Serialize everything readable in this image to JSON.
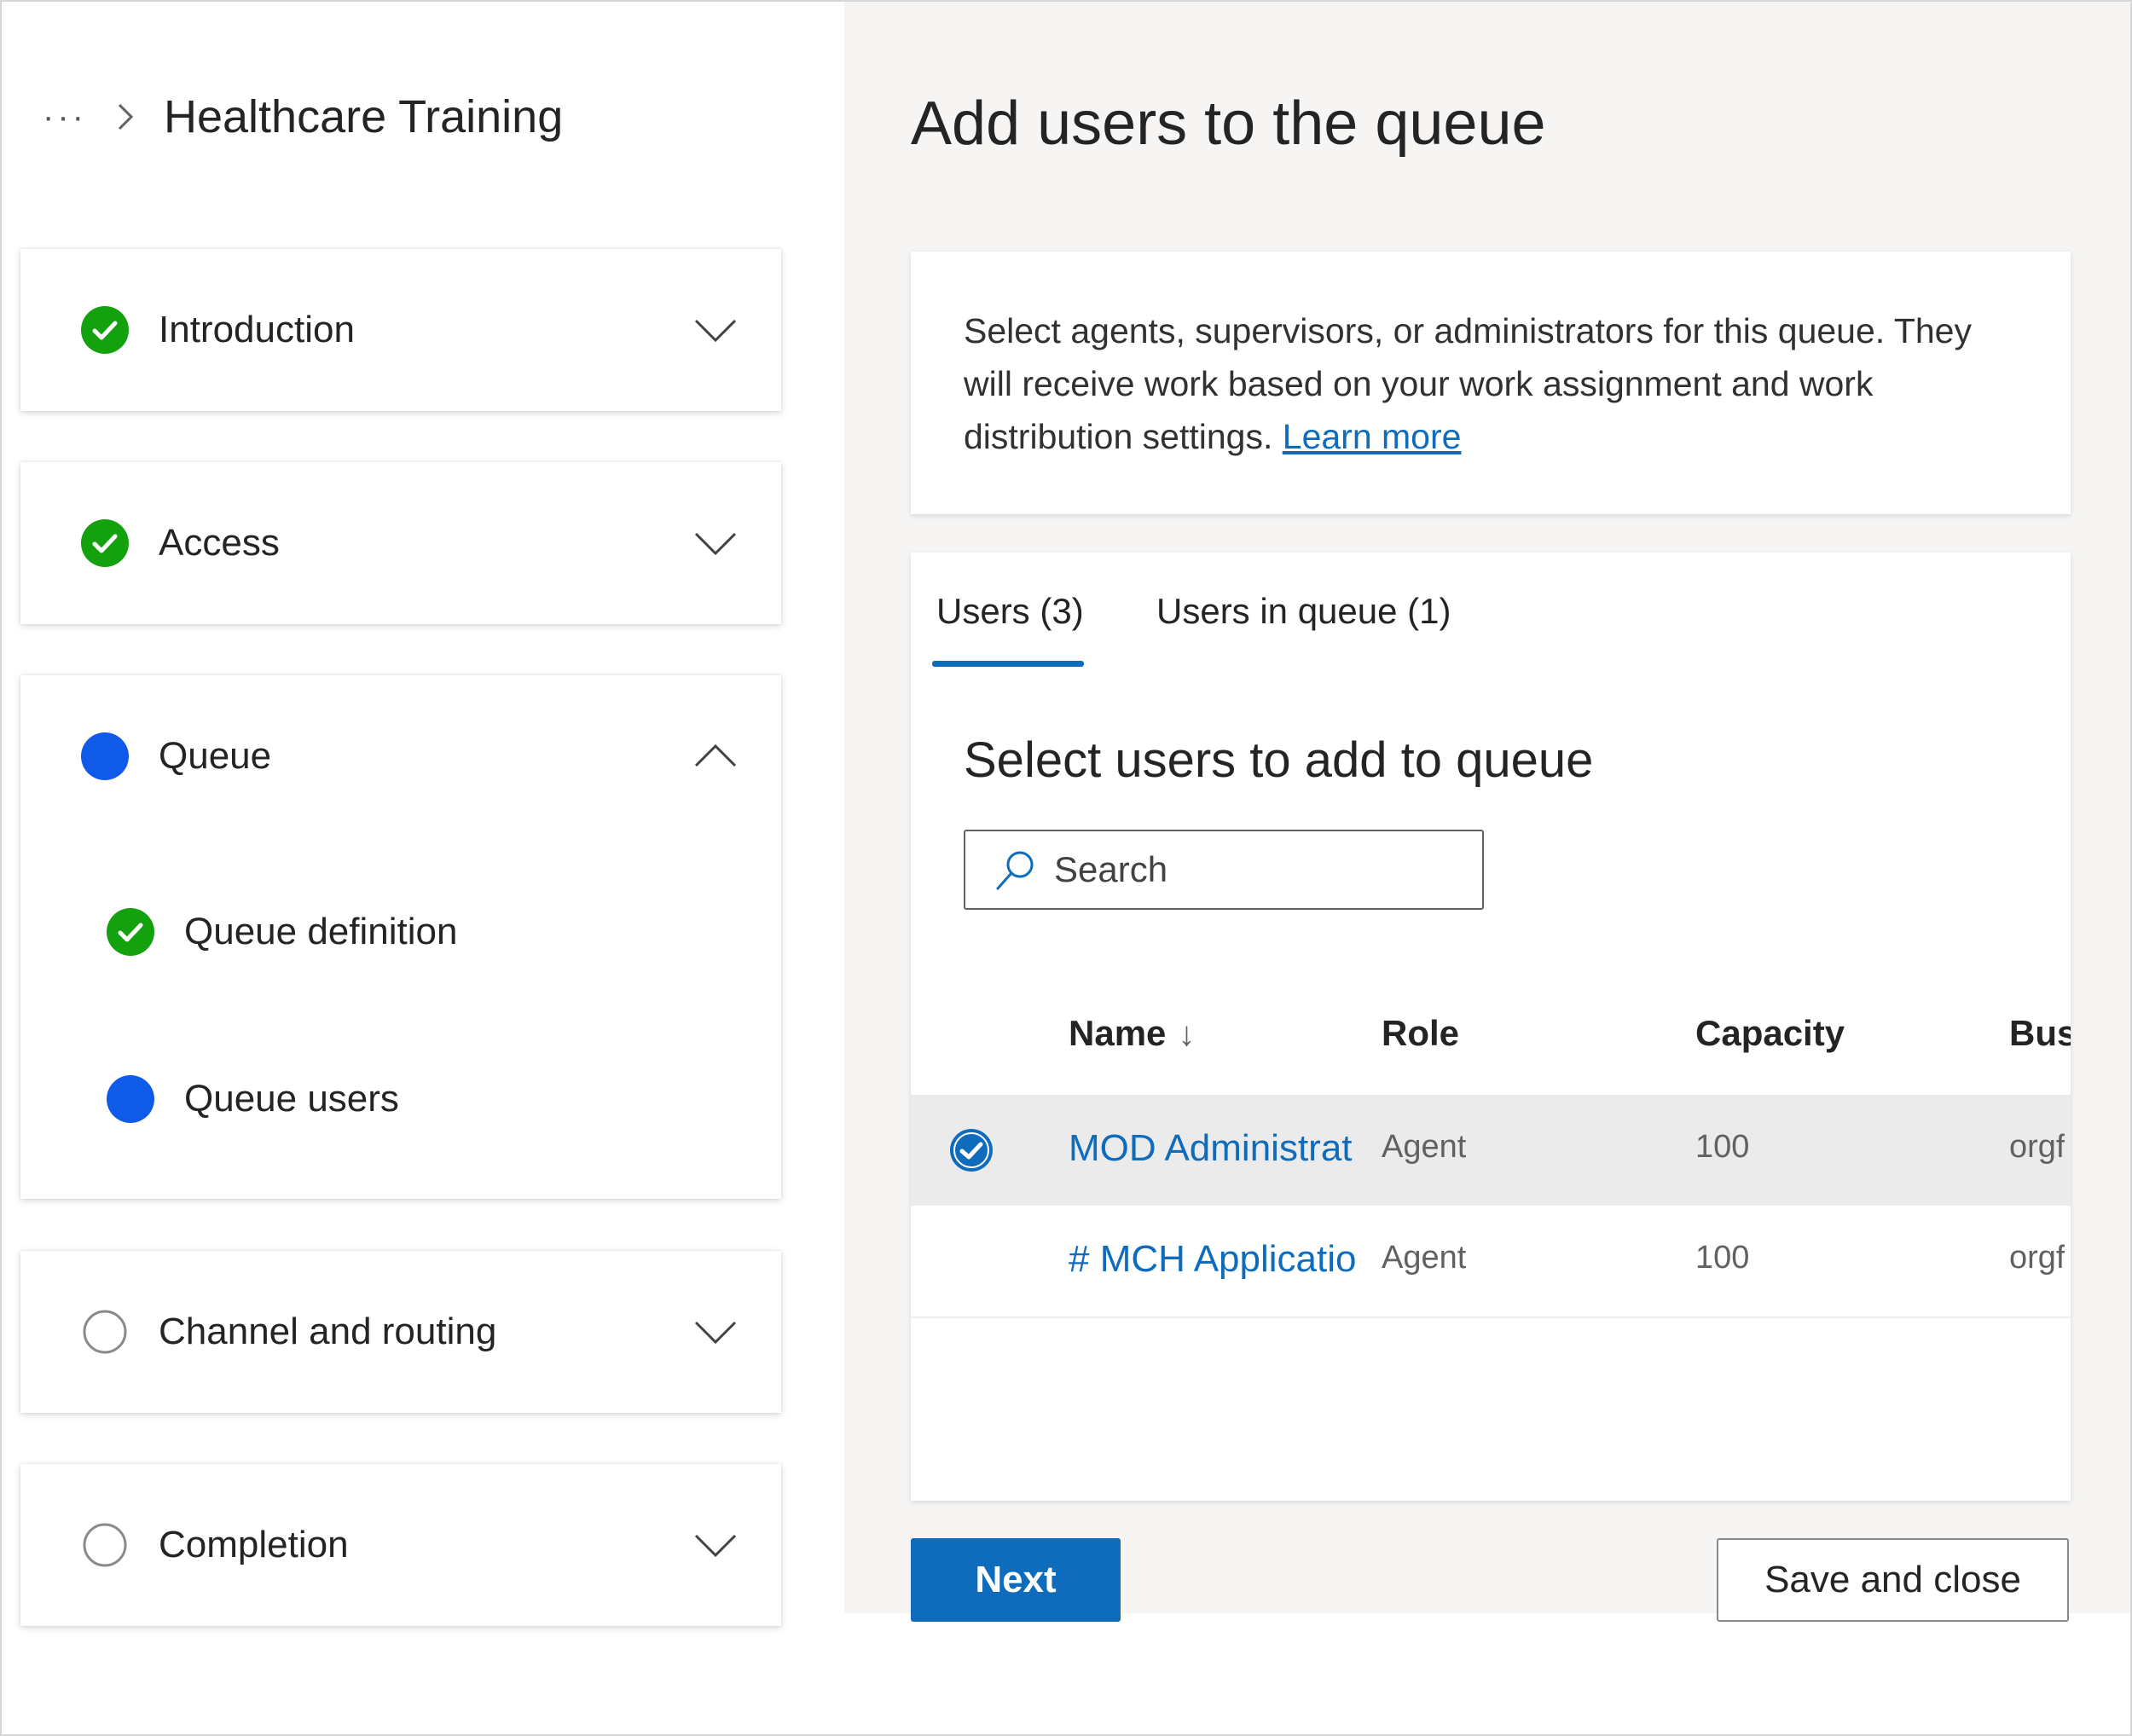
{
  "breadcrumb": {
    "more": "···",
    "title": "Healthcare Training"
  },
  "steps": [
    {
      "label": "Introduction",
      "status": "complete",
      "expanded": false
    },
    {
      "label": "Access",
      "status": "complete",
      "expanded": false
    },
    {
      "label": "Queue",
      "status": "current",
      "expanded": true,
      "substeps": [
        {
          "label": "Queue definition",
          "status": "complete"
        },
        {
          "label": "Queue users",
          "status": "current"
        }
      ]
    },
    {
      "label": "Channel and routing",
      "status": "pending",
      "expanded": false
    },
    {
      "label": "Completion",
      "status": "pending",
      "expanded": false
    }
  ],
  "main": {
    "title": "Add users to the queue",
    "info": {
      "text": "Select agents, supervisors, or administrators for this queue. They will receive work based on your work assignment and work distribution settings.",
      "link": "Learn more"
    },
    "tabs": [
      {
        "label": "Users (3)",
        "active": true
      },
      {
        "label": "Users in queue (1)",
        "active": false
      }
    ],
    "section_title": "Select users to add to queue",
    "search": {
      "placeholder": "Search",
      "value": ""
    },
    "table": {
      "columns": [
        "Name",
        "Role",
        "Capacity",
        "Bus"
      ],
      "sort_indicator": "↓",
      "rows": [
        {
          "name": "MOD Administrat",
          "role": "Agent",
          "capacity": "100",
          "bus": "orgf",
          "selected": true
        },
        {
          "name": "# MCH Applicatio",
          "role": "Agent",
          "capacity": "100",
          "bus": "orgf",
          "selected": false
        }
      ]
    },
    "buttons": {
      "next": "Next",
      "save_close": "Save and close"
    }
  },
  "colors": {
    "accent": "#0f6cbd",
    "complete": "#13a10e",
    "current": "#0f5ae8"
  }
}
